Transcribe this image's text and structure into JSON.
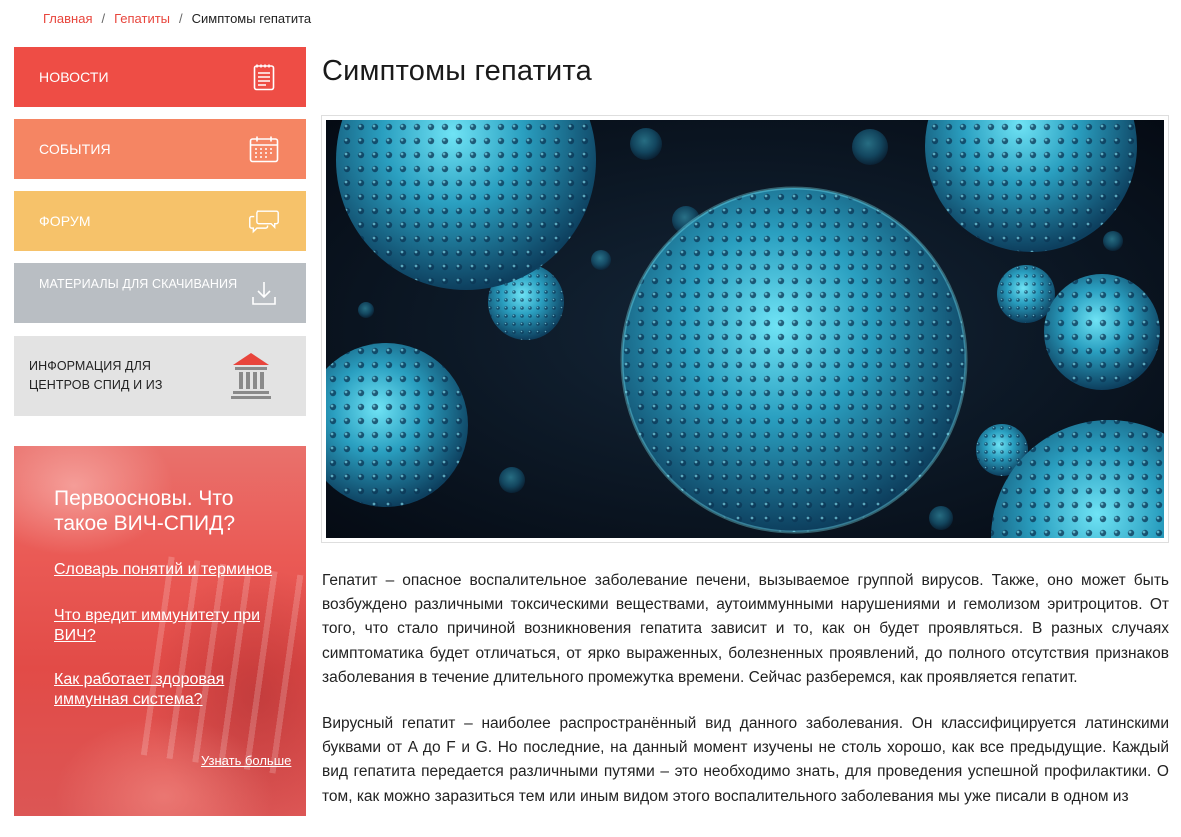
{
  "breadcrumb": {
    "home": "Главная",
    "section": "Гепатиты",
    "current": "Симптомы гепатита",
    "separator": "/"
  },
  "menu": {
    "news": "НОВОСТИ",
    "events": "СОБЫТИЯ",
    "forum": "ФОРУМ",
    "downloads": "МАТЕРИАЛЫ ДЛЯ СКАЧИВАНИЯ",
    "info_line1": "ИНФОРМАЦИЯ ДЛЯ",
    "info_line2": "ЦЕНТРОВ СПИД И ИЗ"
  },
  "promo": {
    "title": "Первоосновы. Что такое ВИЧ-СПИД?",
    "link1": "Словарь понятий и терминов",
    "link2": "Что вредит иммунитету при ВИЧ?",
    "link3": "Как работает здоровая иммунная система?",
    "more": "Узнать больше"
  },
  "page": {
    "title": "Симптомы гепатита"
  },
  "article": {
    "p1": "Гепатит – опасное воспалительное заболевание печени, вызываемое группой вирусов. Также, оно может быть возбуждено различными токсическими веществами, аутоиммунными нарушениями и гемолизом эритроцитов. От того, что стало причиной возникновения гепатита зависит и то, как он будет проявляться. В разных случаях симптоматика будет отличаться, от ярко выраженных, болезненных проявлений, до полного отсутствия признаков заболевания в течение длительного промежутка времени. Сейчас разберемся, как проявляется гепатит.",
    "p2": "Вирусный гепатит – наиболее распространённый вид данного заболевания. Он классифицируется латинскими буквами от A до F и G. Но последние, на данный момент изучены не столь хорошо, как все предыдущие. Каждый вид гепатита передается различными путями – это необходимо знать, для проведения успешной профилактики. О том, как можно заразиться тем или иным видом этого воспалительного заболевания мы уже писали в одном из"
  },
  "colors": {
    "news": "#ee4d45",
    "events": "#f58563",
    "forum": "#f6c26a",
    "downloads": "#b9bec3",
    "info": "#e3e3e3",
    "link": "#e8453c"
  },
  "icons": {
    "news": "newspaper-icon",
    "events": "calendar-icon",
    "forum": "chat-bubbles-icon",
    "downloads": "download-icon",
    "info": "institution-building-icon"
  }
}
